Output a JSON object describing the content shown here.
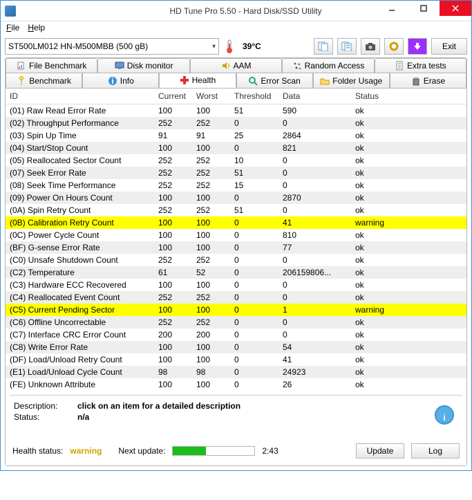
{
  "title": "HD Tune Pro 5.50 - Hard Disk/SSD Utility",
  "menu": {
    "file": "File",
    "help": "Help"
  },
  "drive": "ST500LM012 HN-M500MBB (500 gB)",
  "temperature": "39°C",
  "exit_label": "Exit",
  "tabs_top": [
    "File Benchmark",
    "Disk monitor",
    "AAM",
    "Random Access",
    "Extra tests"
  ],
  "tabs_bottom": [
    "Benchmark",
    "Info",
    "Health",
    "Error Scan",
    "Folder Usage",
    "Erase"
  ],
  "columns": {
    "id": "ID",
    "current": "Current",
    "worst": "Worst",
    "threshold": "Threshold",
    "data": "Data",
    "status": "Status"
  },
  "rows": [
    {
      "id": "(01) Raw Read Error Rate",
      "c": "100",
      "w": "100",
      "t": "51",
      "d": "590",
      "s": "ok",
      "hl": "sel"
    },
    {
      "id": "(02) Throughput Performance",
      "c": "252",
      "w": "252",
      "t": "0",
      "d": "0",
      "s": "ok",
      "hl": "alt"
    },
    {
      "id": "(03) Spin Up Time",
      "c": "91",
      "w": "91",
      "t": "25",
      "d": "2864",
      "s": "ok",
      "hl": ""
    },
    {
      "id": "(04) Start/Stop Count",
      "c": "100",
      "w": "100",
      "t": "0",
      "d": "821",
      "s": "ok",
      "hl": "alt"
    },
    {
      "id": "(05) Reallocated Sector Count",
      "c": "252",
      "w": "252",
      "t": "10",
      "d": "0",
      "s": "ok",
      "hl": ""
    },
    {
      "id": "(07) Seek Error Rate",
      "c": "252",
      "w": "252",
      "t": "51",
      "d": "0",
      "s": "ok",
      "hl": "alt"
    },
    {
      "id": "(08) Seek Time Performance",
      "c": "252",
      "w": "252",
      "t": "15",
      "d": "0",
      "s": "ok",
      "hl": ""
    },
    {
      "id": "(09) Power On Hours Count",
      "c": "100",
      "w": "100",
      "t": "0",
      "d": "2870",
      "s": "ok",
      "hl": "alt"
    },
    {
      "id": "(0A) Spin Retry Count",
      "c": "252",
      "w": "252",
      "t": "51",
      "d": "0",
      "s": "ok",
      "hl": ""
    },
    {
      "id": "(0B) Calibration Retry Count",
      "c": "100",
      "w": "100",
      "t": "0",
      "d": "41",
      "s": "warning",
      "hl": "warn"
    },
    {
      "id": "(0C) Power Cycle Count",
      "c": "100",
      "w": "100",
      "t": "0",
      "d": "810",
      "s": "ok",
      "hl": ""
    },
    {
      "id": "(BF) G-sense Error Rate",
      "c": "100",
      "w": "100",
      "t": "0",
      "d": "77",
      "s": "ok",
      "hl": "alt"
    },
    {
      "id": "(C0) Unsafe Shutdown Count",
      "c": "252",
      "w": "252",
      "t": "0",
      "d": "0",
      "s": "ok",
      "hl": ""
    },
    {
      "id": "(C2) Temperature",
      "c": "61",
      "w": "52",
      "t": "0",
      "d": "206159806...",
      "s": "ok",
      "hl": "alt"
    },
    {
      "id": "(C3) Hardware ECC Recovered",
      "c": "100",
      "w": "100",
      "t": "0",
      "d": "0",
      "s": "ok",
      "hl": ""
    },
    {
      "id": "(C4) Reallocated Event Count",
      "c": "252",
      "w": "252",
      "t": "0",
      "d": "0",
      "s": "ok",
      "hl": "alt"
    },
    {
      "id": "(C5) Current Pending Sector",
      "c": "100",
      "w": "100",
      "t": "0",
      "d": "1",
      "s": "warning",
      "hl": "warn"
    },
    {
      "id": "(C6) Offline Uncorrectable",
      "c": "252",
      "w": "252",
      "t": "0",
      "d": "0",
      "s": "ok",
      "hl": "alt"
    },
    {
      "id": "(C7) Interface CRC Error Count",
      "c": "200",
      "w": "200",
      "t": "0",
      "d": "0",
      "s": "ok",
      "hl": ""
    },
    {
      "id": "(C8) Write Error Rate",
      "c": "100",
      "w": "100",
      "t": "0",
      "d": "54",
      "s": "ok",
      "hl": "alt"
    },
    {
      "id": "(DF) Load/Unload Retry Count",
      "c": "100",
      "w": "100",
      "t": "0",
      "d": "41",
      "s": "ok",
      "hl": ""
    },
    {
      "id": "(E1) Load/Unload Cycle Count",
      "c": "98",
      "w": "98",
      "t": "0",
      "d": "24923",
      "s": "ok",
      "hl": "alt"
    },
    {
      "id": "(FE) Unknown Attribute",
      "c": "100",
      "w": "100",
      "t": "0",
      "d": "26",
      "s": "ok",
      "hl": ""
    }
  ],
  "description": {
    "label": "Description:",
    "value": "click on an item for a detailed description"
  },
  "status_line": {
    "label": "Status:",
    "value": "n/a"
  },
  "footer": {
    "health_label": "Health status:",
    "health_value": "warning",
    "next_update_label": "Next update:",
    "next_update_time": "2:43",
    "update_btn": "Update",
    "log_btn": "Log"
  }
}
